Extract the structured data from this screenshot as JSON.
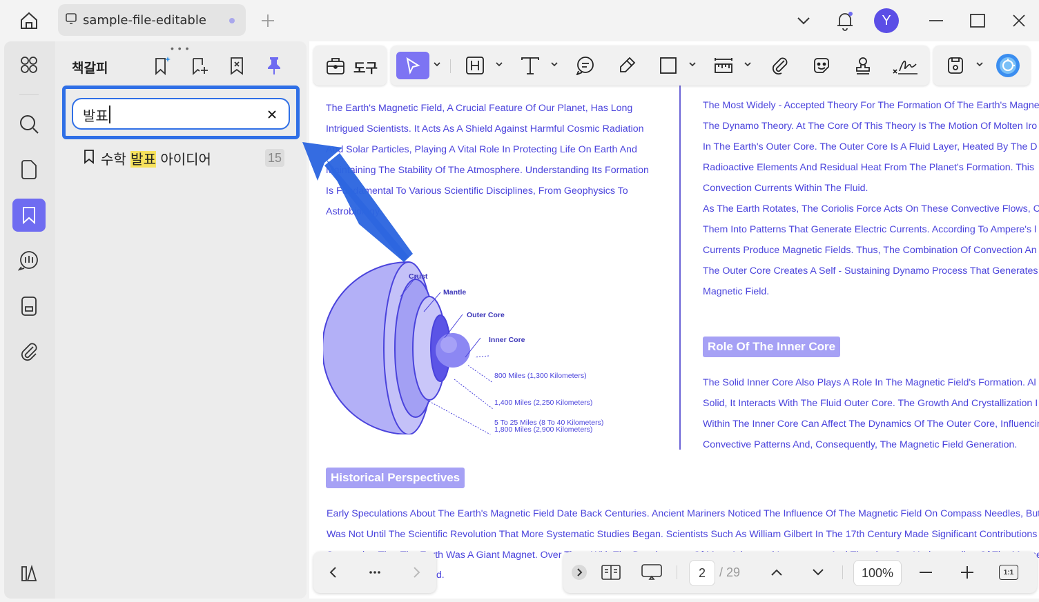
{
  "titlebar": {
    "tab_title": "sample-file-editable",
    "avatar_letter": "Y"
  },
  "panel": {
    "title": "책갈피",
    "search_value": "발표",
    "bookmark": {
      "prefix": "수학 ",
      "highlight": "발표",
      "suffix": " 아이디어",
      "page": "15"
    }
  },
  "toolbar": {
    "tools_label": "도구"
  },
  "doc": {
    "left_column": [
      "The Earth's Magnetic Field, A Crucial Feature Of Our Planet, Has Long",
      "Intrigued Scientists. It Acts As A Shield Against Harmful Cosmic Radiation",
      "And Solar Particles, Playing A Vital Role In Protecting Life On Earth And",
      "Maintaining The Stability Of The Atmosphere. Understanding Its Formation",
      "Is Fundamental To Various Scientific Disciplines, From Geophysics To",
      "Astrobiology."
    ],
    "right_column": [
      "The Most Widely - Accepted Theory For The Formation Of The Earth's Magne",
      "The Dynamo Theory. At The Core Of This Theory Is The Motion Of Molten Iro",
      "In The Earth's Outer Core. The Outer Core Is A Fluid Layer, Heated By The D",
      "Radioactive Elements And Residual Heat From The Planet's Formation. This",
      "Convection Currents Within The Fluid.",
      "As The Earth Rotates, The Coriolis Force Acts On These Convective Flows, C",
      "Them Into Patterns That Generate Electric Currents. According To Ampere's l",
      "Currents Produce Magnetic Fields. Thus, The Combination Of Convection An",
      "The Outer Core Creates A Self - Sustaining Dynamo Process That Generates",
      "Magnetic Field."
    ],
    "inner_core_heading": "Role Of The Inner Core",
    "inner_core_text": [
      "The Solid Inner Core Also Plays A Role In The Magnetic Field's Formation. Al",
      "Solid, It Interacts With The Fluid Outer Core. The Growth And Crystallization I",
      "Within The Inner Core Can Affect The Dynamics Of The Outer Core, Influencin",
      "Convective Patterns And, Consequently, The Magnetic Field Generation."
    ],
    "historical_heading": "Historical Perspectives",
    "historical_text": [
      "Early Speculations About The Earth's Magnetic Field Date Back Centuries. Ancient Mariners Noticed The Influence Of The Magnetic Field On Compass Needles, But",
      "Was Not Until The Scientific Revolution That More Systematic Studies Began. Scientists Such As William Gilbert In The 17th Century Made Significant Contributions E",
      "Suggesting That The Earth Was A Giant Magnet. Over Time, With The Development Of More Advanced Instruments And Theories, Our Understanding Of The Magne"
    ],
    "figure": {
      "labels": [
        "Crust",
        "Mantle",
        "Outer Core",
        "Inner Core"
      ],
      "dimensions": [
        "800 Miles (1,300 Kilometers)",
        "1,400 Miles (2,250 Kilometers)",
        "1,800 Miles (2,900 Kilometers)",
        "5 To 25 Miles (8 To 40 Kilometers)"
      ]
    }
  },
  "bottom": {
    "current_page": "2",
    "total_pages": "/ 29",
    "zoom": "100%",
    "fit_label": "1:1",
    "partial_text": "d."
  },
  "colors": {
    "accent": "#6f6cf1",
    "highlight_frame": "#2f6fe6",
    "doc_text": "#4a43dc",
    "search_highlight": "#f7e25c"
  }
}
